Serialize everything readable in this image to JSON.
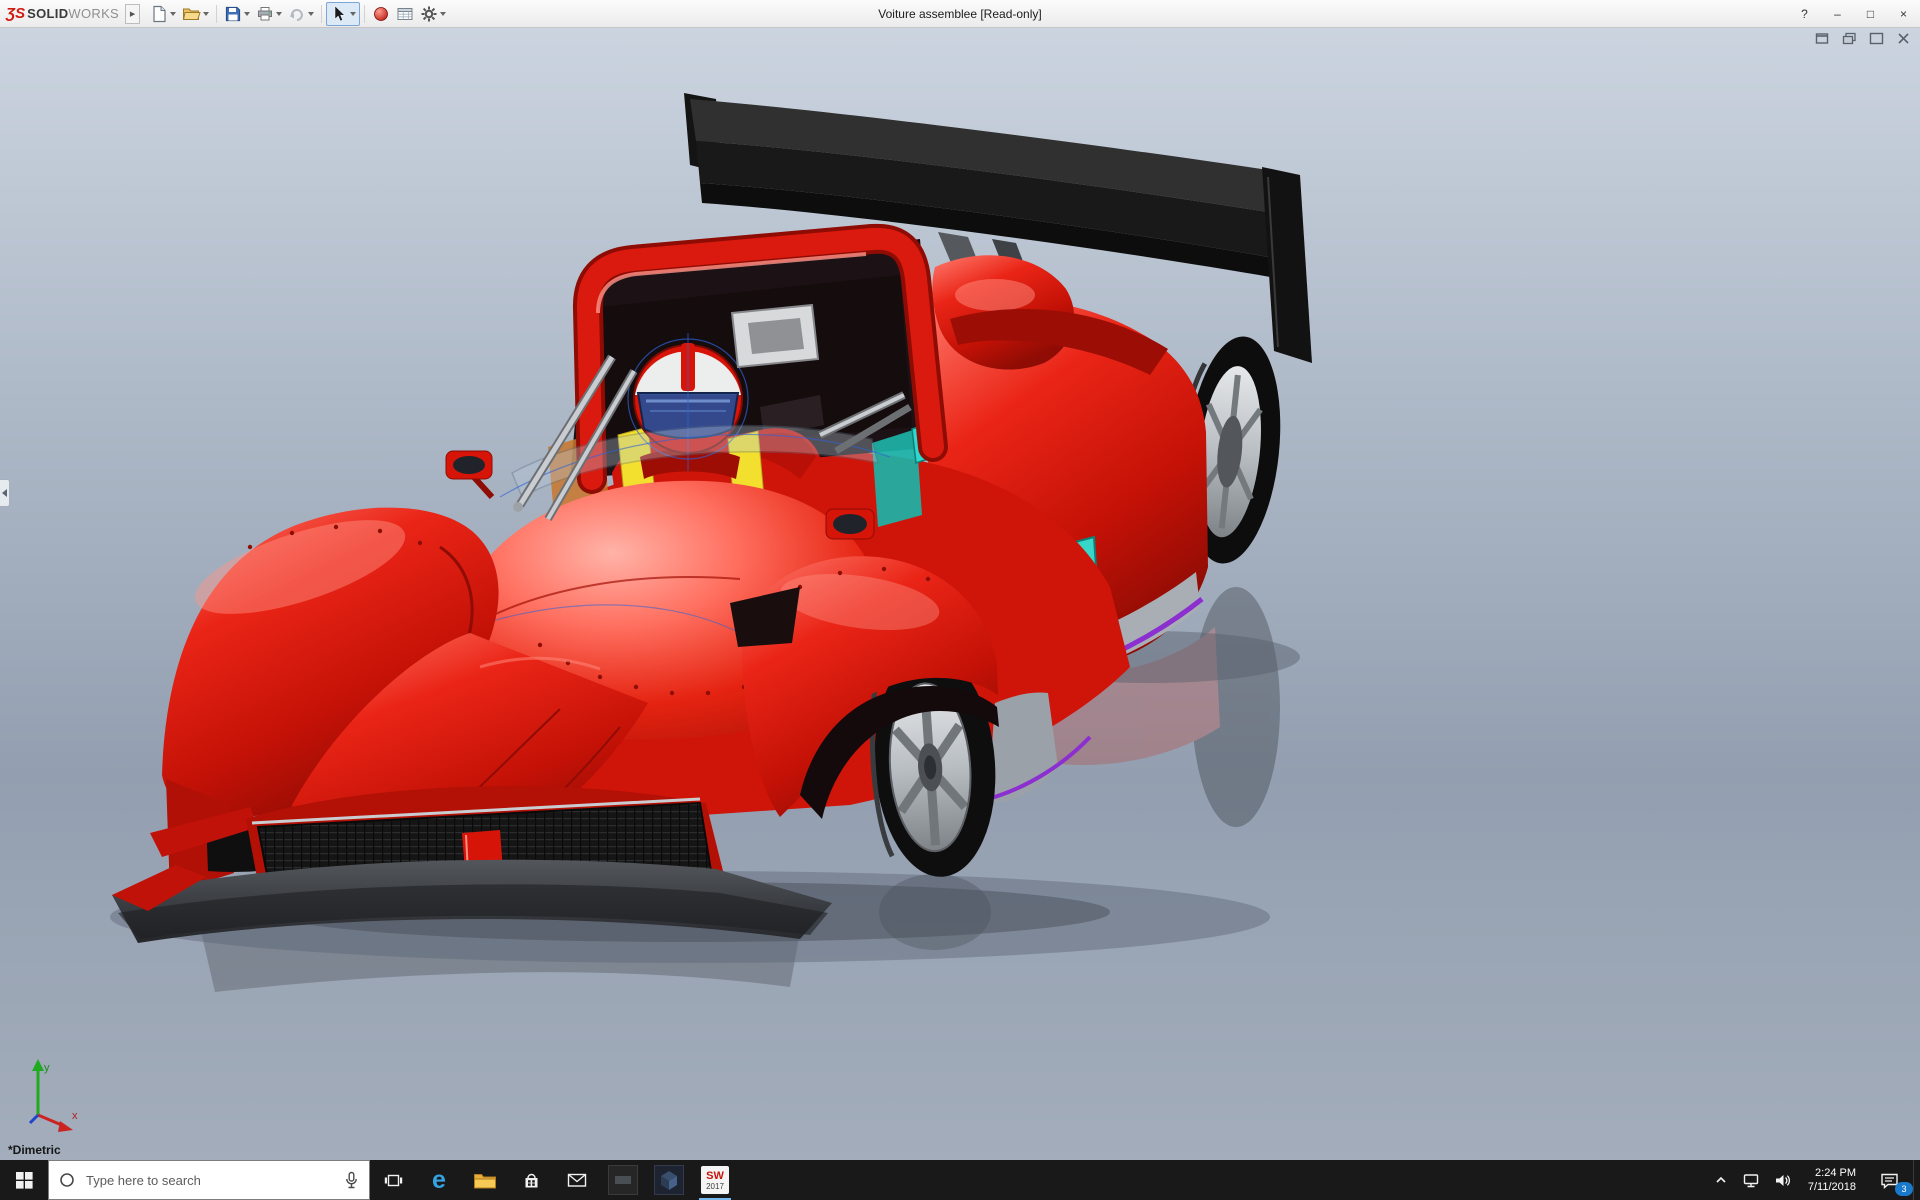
{
  "brand": {
    "mark": "ƷS",
    "solid": "SOLID",
    "works": "WORKS"
  },
  "window": {
    "title": "Voiture assemblee [Read-only]",
    "flyout_arrow": "▶",
    "controls": {
      "help": "?",
      "minimize": "–",
      "maximize": "□",
      "close": "×"
    }
  },
  "viewport": {
    "view_label": "*Dimetric",
    "triad": {
      "x_label": "x",
      "y_label": "y"
    }
  },
  "taskbar": {
    "search_placeholder": "Type here to search",
    "edge_letter": "e",
    "solidworks_icon": {
      "text": "SW",
      "year": "2017"
    },
    "clock": {
      "time": "2:24 PM",
      "date": "7/11/2018"
    },
    "action_center_badge": "3"
  }
}
